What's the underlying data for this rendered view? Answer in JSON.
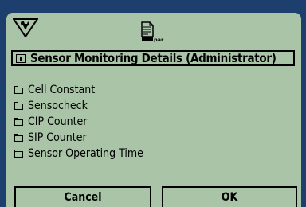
{
  "toolbar": {
    "wrench_icon": "wrench-icon",
    "doc_icon": "parameter-document-icon",
    "doc_icon_caption": "par"
  },
  "title": {
    "icon": "info-box-icon",
    "text": "Sensor Monitoring Details (Administrator)"
  },
  "menu": {
    "items": [
      {
        "icon": "folder-icon",
        "label": "Cell Constant"
      },
      {
        "icon": "folder-icon",
        "label": "Sensocheck"
      },
      {
        "icon": "folder-icon",
        "label": "CIP Counter"
      },
      {
        "icon": "folder-icon",
        "label": "SIP Counter"
      },
      {
        "icon": "folder-icon",
        "label": "Sensor Operating Time"
      }
    ]
  },
  "softkeys": {
    "cancel_label": "Cancel",
    "ok_label": "OK"
  },
  "colors": {
    "bezel": "#1d3f6e",
    "screen": "#a9c4a6",
    "ink": "#000000"
  }
}
